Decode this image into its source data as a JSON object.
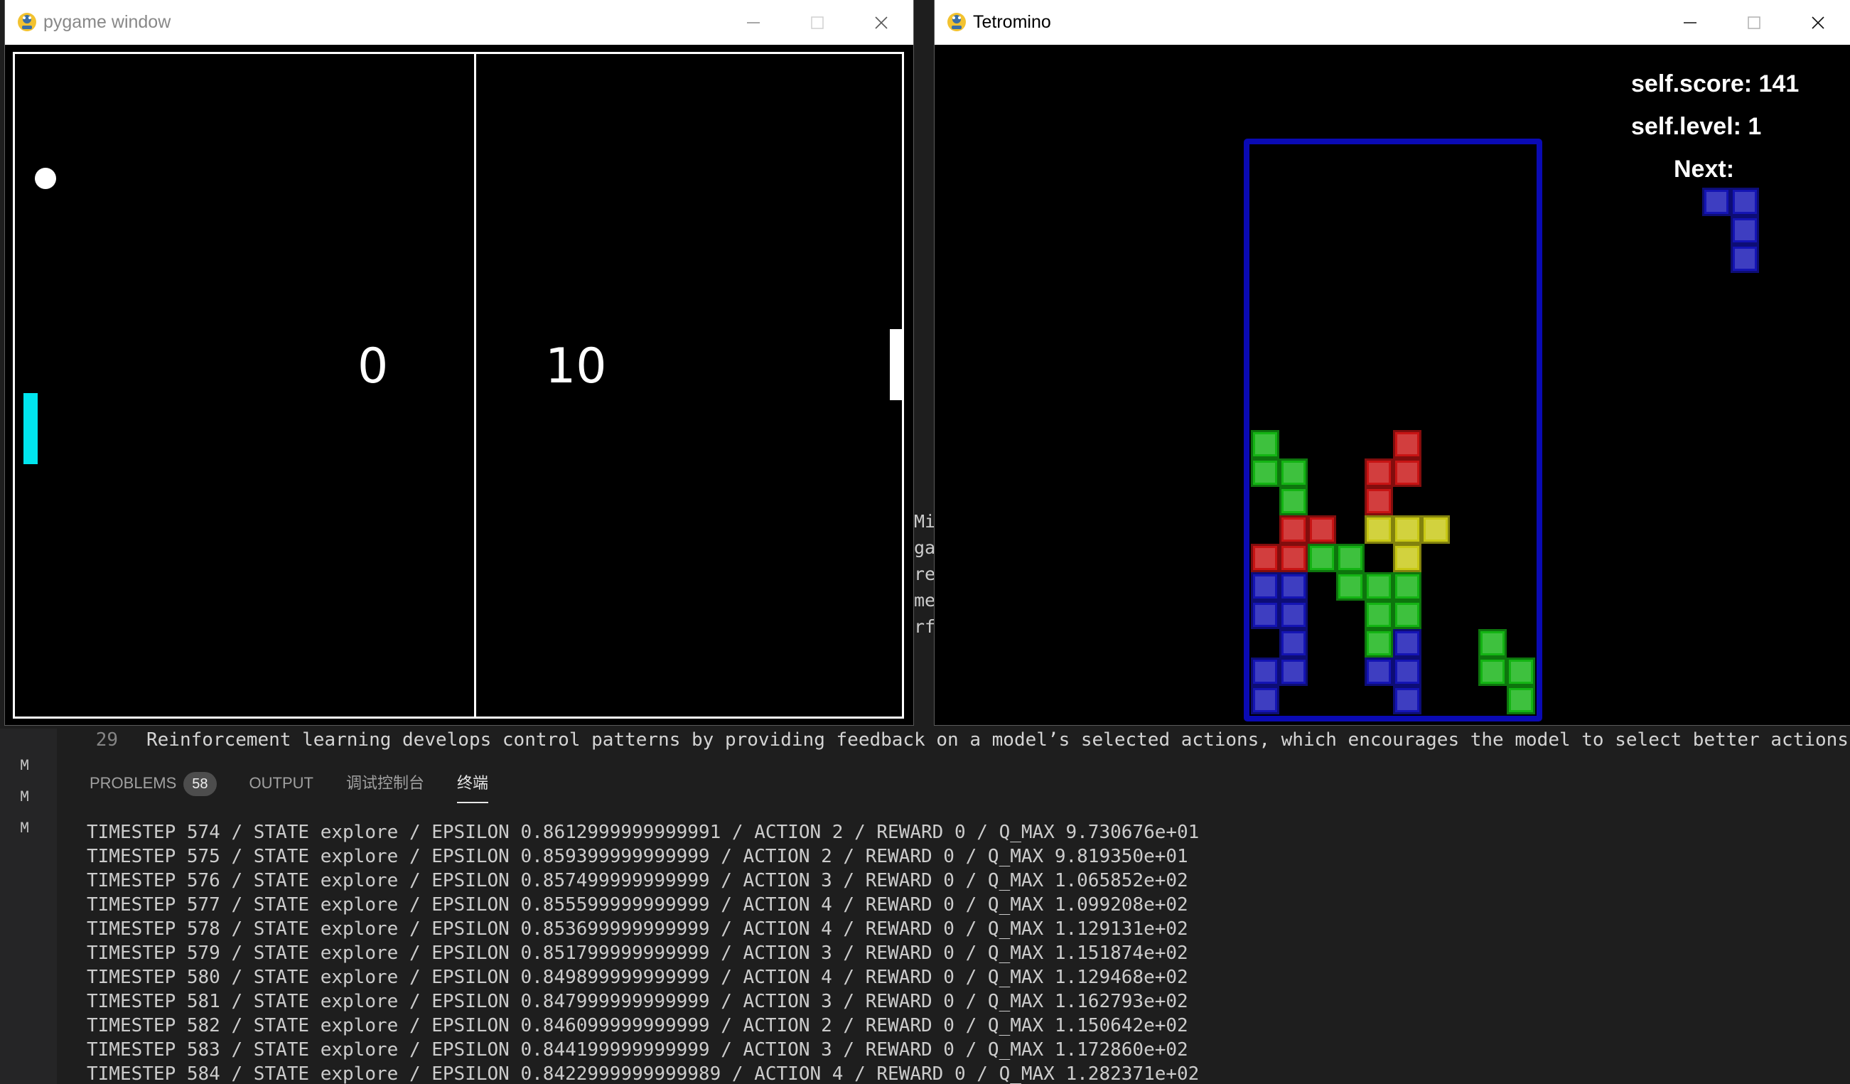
{
  "colors": {
    "vscode_bg": "#1e1e1e",
    "paddle_left": "#00e5ee",
    "tetris_red": "#c81414",
    "tetris_green": "#14b414",
    "tetris_blue": "#1414b4",
    "tetris_yellow": "#c8c814",
    "board_border": "#0a0ab4"
  },
  "pong_window": {
    "title": "pygame window",
    "icon": "pygame-snake-icon",
    "score_left": "0",
    "score_right": "10"
  },
  "tetris_window": {
    "title": "Tetromino",
    "icon": "pygame-snake-icon",
    "score_text": "self.score: 141",
    "level_text": "self.level: 1",
    "next_label": "Next:",
    "board": {
      "cols": 10,
      "rows": 20,
      "cells": [
        {
          "col": 0,
          "row": 10,
          "color": "green"
        },
        {
          "col": 5,
          "row": 10,
          "color": "red"
        },
        {
          "col": 0,
          "row": 11,
          "color": "green"
        },
        {
          "col": 1,
          "row": 11,
          "color": "green"
        },
        {
          "col": 4,
          "row": 11,
          "color": "red"
        },
        {
          "col": 5,
          "row": 11,
          "color": "red"
        },
        {
          "col": 1,
          "row": 12,
          "color": "green"
        },
        {
          "col": 4,
          "row": 12,
          "color": "red"
        },
        {
          "col": 1,
          "row": 13,
          "color": "red"
        },
        {
          "col": 2,
          "row": 13,
          "color": "red"
        },
        {
          "col": 4,
          "row": 13,
          "color": "yellow"
        },
        {
          "col": 5,
          "row": 13,
          "color": "yellow"
        },
        {
          "col": 6,
          "row": 13,
          "color": "yellow"
        },
        {
          "col": 0,
          "row": 14,
          "color": "red"
        },
        {
          "col": 1,
          "row": 14,
          "color": "red"
        },
        {
          "col": 2,
          "row": 14,
          "color": "green"
        },
        {
          "col": 3,
          "row": 14,
          "color": "green"
        },
        {
          "col": 5,
          "row": 14,
          "color": "yellow"
        },
        {
          "col": 0,
          "row": 15,
          "color": "blue"
        },
        {
          "col": 1,
          "row": 15,
          "color": "blue"
        },
        {
          "col": 3,
          "row": 15,
          "color": "green"
        },
        {
          "col": 4,
          "row": 15,
          "color": "green"
        },
        {
          "col": 5,
          "row": 15,
          "color": "green"
        },
        {
          "col": 0,
          "row": 16,
          "color": "blue"
        },
        {
          "col": 1,
          "row": 16,
          "color": "blue"
        },
        {
          "col": 4,
          "row": 16,
          "color": "green"
        },
        {
          "col": 5,
          "row": 16,
          "color": "green"
        },
        {
          "col": 1,
          "row": 17,
          "color": "blue"
        },
        {
          "col": 4,
          "row": 17,
          "color": "green"
        },
        {
          "col": 5,
          "row": 17,
          "color": "blue"
        },
        {
          "col": 8,
          "row": 17,
          "color": "green"
        },
        {
          "col": 0,
          "row": 18,
          "color": "blue"
        },
        {
          "col": 1,
          "row": 18,
          "color": "blue"
        },
        {
          "col": 4,
          "row": 18,
          "color": "blue"
        },
        {
          "col": 5,
          "row": 18,
          "color": "blue"
        },
        {
          "col": 8,
          "row": 18,
          "color": "green"
        },
        {
          "col": 9,
          "row": 18,
          "color": "green"
        },
        {
          "col": 0,
          "row": 19,
          "color": "blue"
        },
        {
          "col": 5,
          "row": 19,
          "color": "blue"
        },
        {
          "col": 9,
          "row": 19,
          "color": "green"
        }
      ]
    },
    "next_piece": {
      "color": "blue",
      "cells": [
        {
          "col": 0,
          "row": 0
        },
        {
          "col": 1,
          "row": 0
        },
        {
          "col": 1,
          "row": 1
        },
        {
          "col": 1,
          "row": 2
        }
      ]
    }
  },
  "editor": {
    "line_number": "29",
    "line_text": "Reinforcement learning develops control patterns by providing feedback on a model’s selected actions, which encourages the model to select better actions i",
    "peek_left": [
      "Mi",
      "ga",
      "re",
      "me",
      "rfo"
    ],
    "git_markers": [
      "M",
      "M",
      "M"
    ]
  },
  "panel": {
    "tabs": [
      {
        "label": "PROBLEMS",
        "badge": "58"
      },
      {
        "label": "OUTPUT"
      },
      {
        "label": "调试控制台"
      },
      {
        "label": "终端",
        "active": true
      }
    ],
    "terminal_lines": [
      "TIMESTEP 574 / STATE explore / EPSILON 0.8612999999999991 / ACTION 2 / REWARD 0 / Q_MAX 9.730676e+01",
      "TIMESTEP 575 / STATE explore / EPSILON 0.859399999999999 / ACTION 2 / REWARD 0 / Q_MAX 9.819350e+01",
      "TIMESTEP 576 / STATE explore / EPSILON 0.857499999999999 / ACTION 3 / REWARD 0 / Q_MAX 1.065852e+02",
      "TIMESTEP 577 / STATE explore / EPSILON 0.855599999999999 / ACTION 4 / REWARD 0 / Q_MAX 1.099208e+02",
      "TIMESTEP 578 / STATE explore / EPSILON 0.853699999999999 / ACTION 4 / REWARD 0 / Q_MAX 1.129131e+02",
      "TIMESTEP 579 / STATE explore / EPSILON 0.851799999999999 / ACTION 3 / REWARD 0 / Q_MAX 1.151874e+02",
      "TIMESTEP 580 / STATE explore / EPSILON 0.849899999999999 / ACTION 4 / REWARD 0 / Q_MAX 1.129468e+02",
      "TIMESTEP 581 / STATE explore / EPSILON 0.847999999999999 / ACTION 3 / REWARD 0 / Q_MAX 1.162793e+02",
      "TIMESTEP 582 / STATE explore / EPSILON 0.846099999999999 / ACTION 2 / REWARD 0 / Q_MAX 1.150642e+02",
      "TIMESTEP 583 / STATE explore / EPSILON 0.844199999999999 / ACTION 3 / REWARD 0 / Q_MAX 1.172860e+02",
      "TIMESTEP 584 / STATE explore / EPSILON 0.8422999999999989 / ACTION 4 / REWARD 0 / Q_MAX 1.282371e+02"
    ]
  }
}
